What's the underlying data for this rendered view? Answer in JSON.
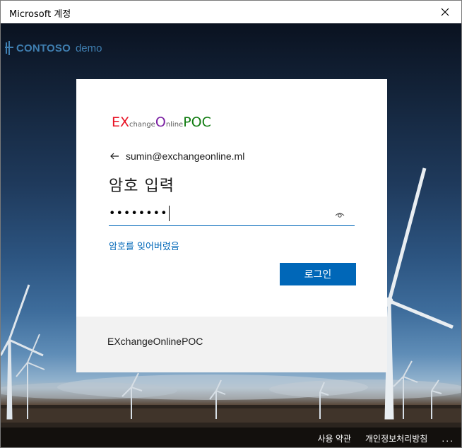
{
  "window": {
    "title": "Microsoft 계정"
  },
  "background": {
    "logo_brand": "CONTOSO",
    "logo_suffix": "demo",
    "brand_color": "#3f7fb1"
  },
  "card": {
    "org_logo": [
      {
        "text": "EX",
        "size": "big",
        "color": "#e81123"
      },
      {
        "text": "change",
        "size": "small",
        "color": "#5c5c5c"
      },
      {
        "text": "O",
        "size": "big",
        "color": "#7a1fa2"
      },
      {
        "text": "nline",
        "size": "small",
        "color": "#5c5c5c"
      },
      {
        "text": "POC",
        "size": "big",
        "color": "#107c10"
      }
    ],
    "identity_email": "sumin@exchangeonline.ml",
    "heading": "암호 입력",
    "password_mask": "••••••••",
    "forgot_link": "암호를 잊어버렸음",
    "signin_button": "로그인",
    "footer_text": "EXchangeOnlinePOC",
    "accent_color": "#0067b8"
  },
  "footer": {
    "terms": "사용 약관",
    "privacy": "개인정보처리방침",
    "more": "..."
  }
}
